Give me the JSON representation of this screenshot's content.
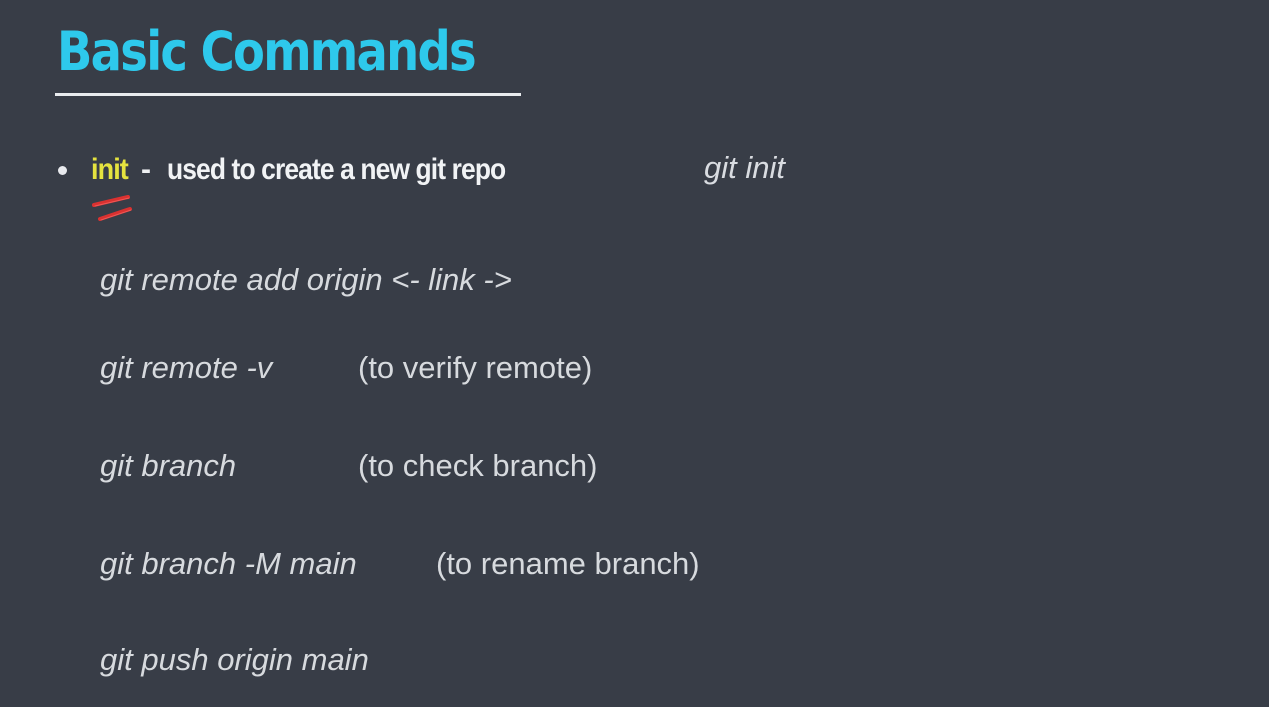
{
  "slide": {
    "title": "Basic Commands",
    "bullet": {
      "keyword": "init",
      "separator": "-",
      "description": "used to create a new git repo",
      "example": "git init"
    },
    "commands": [
      {
        "cmd": "git remote add origin <- link ->",
        "note": ""
      },
      {
        "cmd": "git remote -v",
        "note": "(to verify remote)"
      },
      {
        "cmd": "git branch",
        "note": "(to check branch)"
      },
      {
        "cmd": "git branch -M main",
        "note": "(to rename branch)"
      },
      {
        "cmd": "git push origin main",
        "note": ""
      }
    ],
    "colors": {
      "background": "#383d47",
      "title": "#2ec9ec",
      "keyword_highlight": "#e5e33f",
      "annotation": "#e8302f"
    },
    "annotation_icon": "red-underline-scribble-icon"
  }
}
